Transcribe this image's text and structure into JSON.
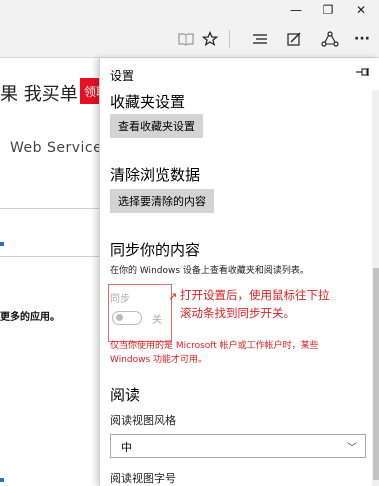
{
  "titlebar": {
    "minimize": "—",
    "restore": "❐",
    "close": "✕"
  },
  "toolbar": {
    "icons": [
      "reading-view-icon",
      "favorite-star-icon",
      "hub-icon",
      "web-note-icon",
      "share-icon",
      "more-icon"
    ],
    "more": "···"
  },
  "webpage": {
    "title": "果 我买单",
    "red_button": "领取",
    "service_text": "Web Service",
    "apps_text": "更多的应用。"
  },
  "settings": {
    "title": "设置",
    "favorites": {
      "title": "收藏夹设置",
      "button": "查看收藏夹设置"
    },
    "clear": {
      "title": "清除浏览数据",
      "button": "选择要清除的内容"
    },
    "sync": {
      "title": "同步你的内容",
      "desc": "在你的 Windows 设备上查看收藏夹和阅读列表。",
      "toggle_label": "同步",
      "toggle_state": "关",
      "warning_line1": "仅当你使用的是 Microsoft 帐户或工作帐户时，某些",
      "warning_line2": "Windows 功能才可用。"
    },
    "reading": {
      "title": "阅读",
      "style_label": "阅读视图风格",
      "style_value": "中",
      "font_label": "阅读视图字号"
    }
  },
  "annotation": {
    "line1": "打开设置后，使用鼠标往下拉",
    "line2": "滚动条找到同步开关。",
    "color": "#e02020"
  }
}
